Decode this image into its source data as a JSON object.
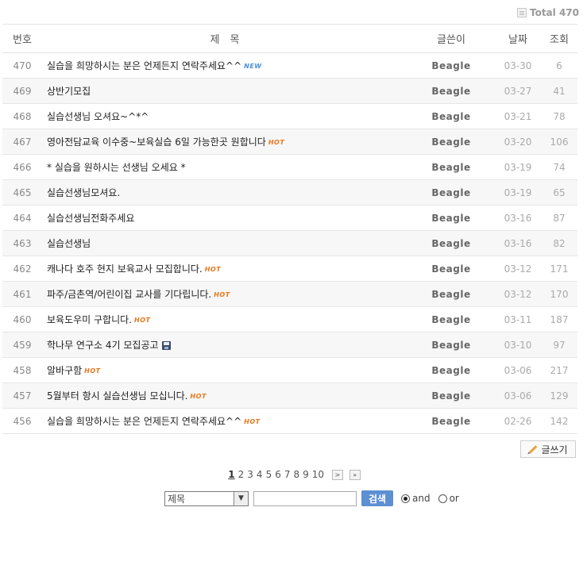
{
  "total_label": "Total 470",
  "headers": {
    "num": "번호",
    "title": "제　목",
    "writer": "글쓴이",
    "date": "날짜",
    "hit": "조회"
  },
  "posts": [
    {
      "num": "470",
      "title": "실습을 희망하시는 분은 언제든지 연락주세요^^",
      "badge": "NEW",
      "writer": "Beagle",
      "date": "03-30",
      "hit": "6"
    },
    {
      "num": "469",
      "title": "상반기모집",
      "badge": "",
      "writer": "Beagle",
      "date": "03-27",
      "hit": "41"
    },
    {
      "num": "468",
      "title": "실습선생님 오셔요~^*^",
      "badge": "",
      "writer": "Beagle",
      "date": "03-21",
      "hit": "78"
    },
    {
      "num": "467",
      "title": "영아전담교육 이수중~보육실습 6일 가능한곳 원합니다",
      "badge": "HOT",
      "writer": "Beagle",
      "date": "03-20",
      "hit": "106"
    },
    {
      "num": "466",
      "title": "* 실습을 원하시는 선생님 오세요 *",
      "badge": "",
      "writer": "Beagle",
      "date": "03-19",
      "hit": "74"
    },
    {
      "num": "465",
      "title": "실습선생님모셔요.",
      "badge": "",
      "writer": "Beagle",
      "date": "03-19",
      "hit": "65"
    },
    {
      "num": "464",
      "title": "실습선생님전화주세요",
      "badge": "",
      "writer": "Beagle",
      "date": "03-16",
      "hit": "87"
    },
    {
      "num": "463",
      "title": "실습선생님",
      "badge": "",
      "writer": "Beagle",
      "date": "03-16",
      "hit": "82"
    },
    {
      "num": "462",
      "title": "캐나다 호주 현지 보육교사 모집합니다.",
      "badge": "HOT",
      "writer": "Beagle",
      "date": "03-12",
      "hit": "171"
    },
    {
      "num": "461",
      "title": "파주/금촌역/어린이집 교사를 기다립니다.",
      "badge": "HOT",
      "writer": "Beagle",
      "date": "03-12",
      "hit": "170"
    },
    {
      "num": "460",
      "title": "보육도우미 구합니다.",
      "badge": "HOT",
      "writer": "Beagle",
      "date": "03-11",
      "hit": "187"
    },
    {
      "num": "459",
      "title": "학나무 연구소 4기 모집공고",
      "badge": "FILE",
      "writer": "Beagle",
      "date": "03-10",
      "hit": "97"
    },
    {
      "num": "458",
      "title": "알바구함",
      "badge": "HOT",
      "writer": "Beagle",
      "date": "03-06",
      "hit": "217"
    },
    {
      "num": "457",
      "title": "5월부터 항시 실습선생님 모십니다.",
      "badge": "HOT",
      "writer": "Beagle",
      "date": "03-06",
      "hit": "129"
    },
    {
      "num": "456",
      "title": "실습을 희망하시는 분은 언제든지 연락주세요^^",
      "badge": "HOT",
      "writer": "Beagle",
      "date": "02-26",
      "hit": "142"
    }
  ],
  "write_label": "글쓰기",
  "pagination": {
    "pages": [
      "1",
      "2",
      "3",
      "4",
      "5",
      "6",
      "7",
      "8",
      "9",
      "10"
    ],
    "current": "1",
    "next": ">",
    "last": "»"
  },
  "search": {
    "field_selected": "제목",
    "button_label": "검색",
    "and_label": "and",
    "or_label": "or",
    "mode": "and"
  }
}
